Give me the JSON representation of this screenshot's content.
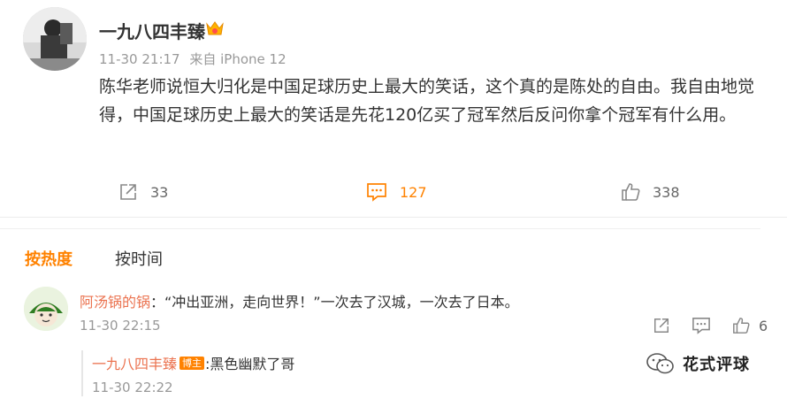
{
  "post": {
    "author": "一九八四丰臻",
    "time": "11-30 21:17",
    "source": "来自 iPhone 12",
    "text": "陈华老师说恒大归化是中国足球历史上最大的笑话，这个真的是陈处的自由。我自由地觉得，中国足球历史上最大的笑话是先花120亿买了冠军然后反问你拿个冠军有什么用。",
    "reposts": "33",
    "comments": "127",
    "likes": "338"
  },
  "sort": {
    "hot": "按热度",
    "time": "按时间"
  },
  "comment": {
    "user": "阿汤锅的锅",
    "text": "：“冲出亚洲，走向世界！”一次去了汉城，一次去了日本。",
    "time": "11-30 22:15",
    "likes": "6"
  },
  "reply": {
    "user": "一九八四丰臻",
    "badge": "博主",
    "text": ":黑色幽默了哥",
    "time": "11-30 22:22"
  },
  "watermark": {
    "text": "花式评球"
  },
  "colors": {
    "accent": "#ff8200",
    "username": "#eb7350",
    "muted": "#999999"
  }
}
